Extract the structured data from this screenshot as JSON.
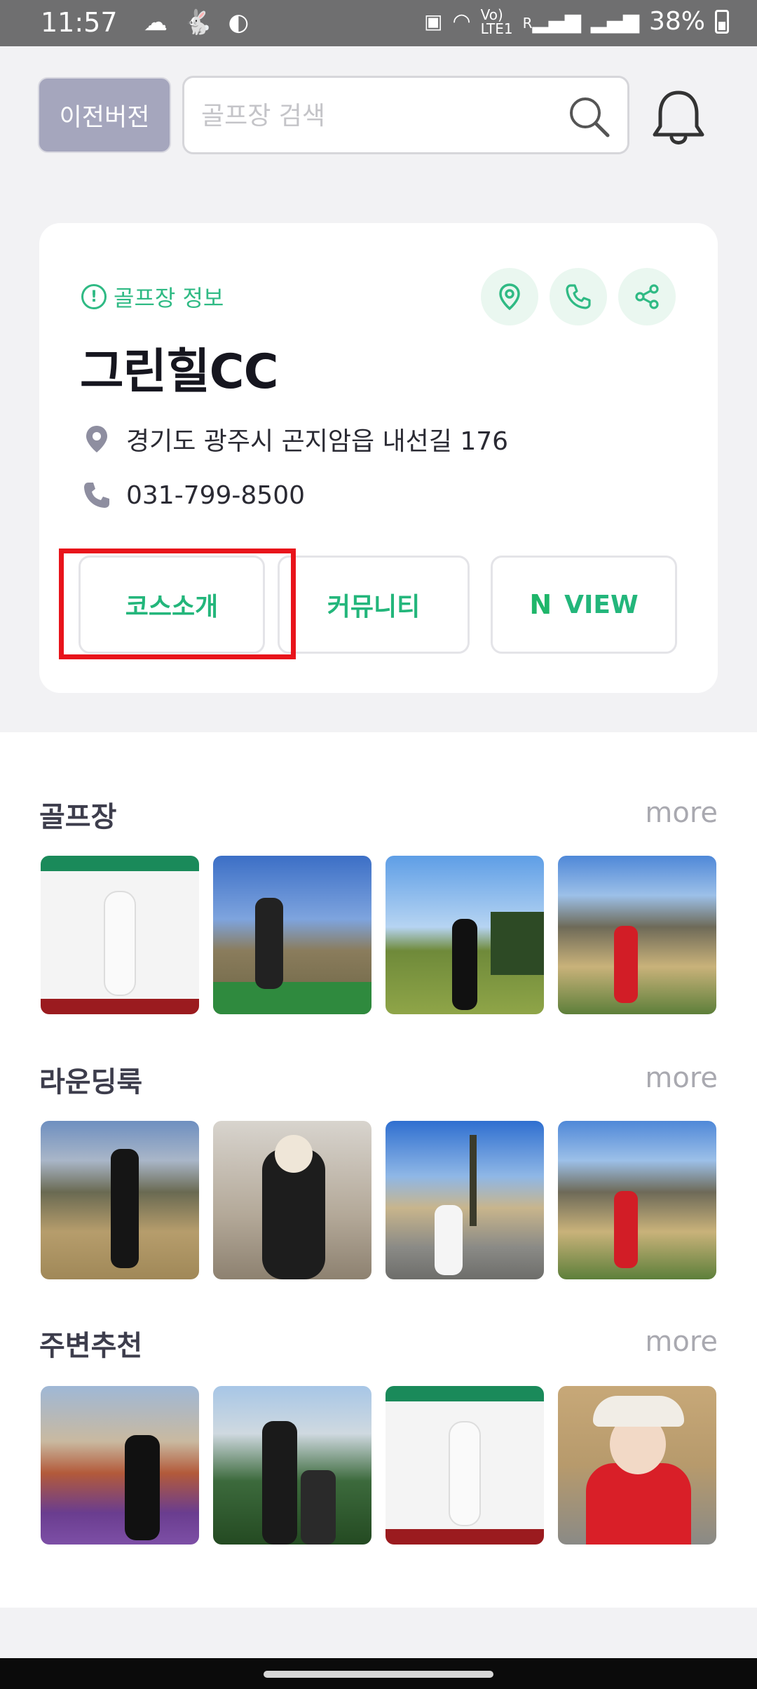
{
  "status_bar": {
    "time": "11:57",
    "battery": "38%",
    "net_small_top": "Vo)",
    "net_small_bottom": "LTE1",
    "net_r": "R"
  },
  "header": {
    "legacy_button": "이전버전",
    "search_placeholder": "골프장 검색"
  },
  "info_card": {
    "tag": "골프장 정보",
    "name": "그린힐CC",
    "address": "경기도 광주시 곤지암읍 내선길 176",
    "phone": "031-799-8500",
    "buttons": {
      "course": "코스소개",
      "community": "커뮤니티",
      "view_logo": "N",
      "view": "VIEW"
    }
  },
  "sections": [
    {
      "title": "골프장",
      "more": "more"
    },
    {
      "title": "라운딩룩",
      "more": "more"
    },
    {
      "title": "주변추천",
      "more": "more"
    }
  ],
  "colors": {
    "accent_green": "#2fba84",
    "highlight_red": "#e8141b",
    "legacy_button_bg": "#a5a6bd"
  }
}
